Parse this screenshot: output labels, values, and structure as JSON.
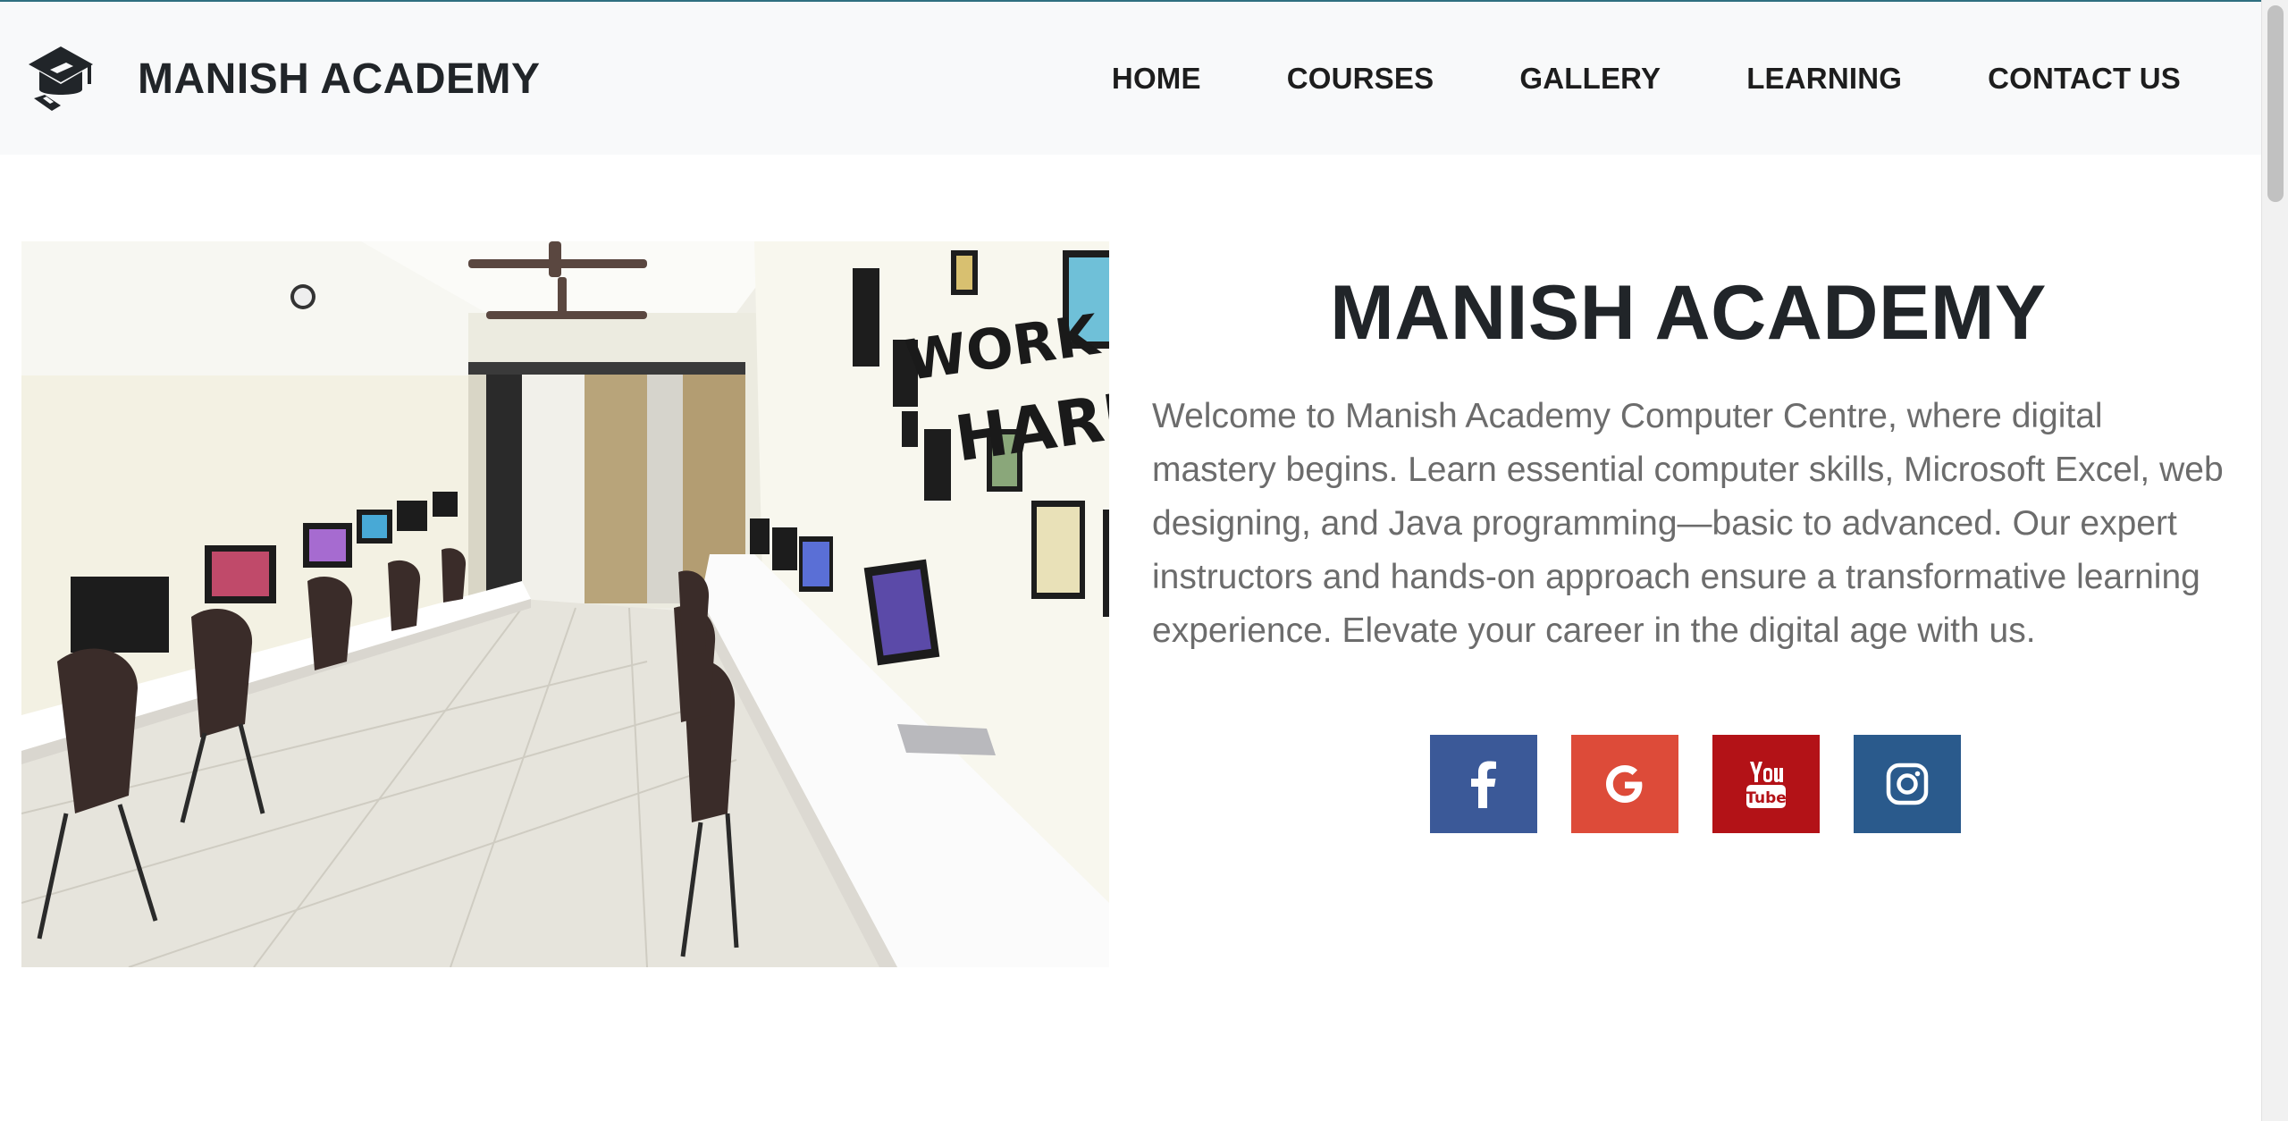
{
  "navbar": {
    "brand": "MANISH ACADEMY",
    "links": [
      "HOME",
      "COURSES",
      "GALLERY",
      "LEARNING",
      "CONTACT US"
    ]
  },
  "hero": {
    "title": "MANISH ACADEMY",
    "description": "Welcome to Manish Academy Computer Centre, where digital mastery begins. Learn essential computer skills, Microsoft Excel, web designing, and Java programming—basic to advanced. Our expert instructors and hands-on approach ensure a transformative learning experience. Elevate your career in the digital age with us.",
    "photo_wall_text": [
      "WORK",
      "HARD"
    ]
  },
  "social": [
    {
      "icon": "facebook-icon",
      "color": "#3b5998"
    },
    {
      "icon": "google-icon",
      "color": "#dd4b39"
    },
    {
      "icon": "youtube-icon",
      "color": "#b31217"
    },
    {
      "icon": "instagram-icon",
      "color": "#2a5a8c"
    }
  ]
}
